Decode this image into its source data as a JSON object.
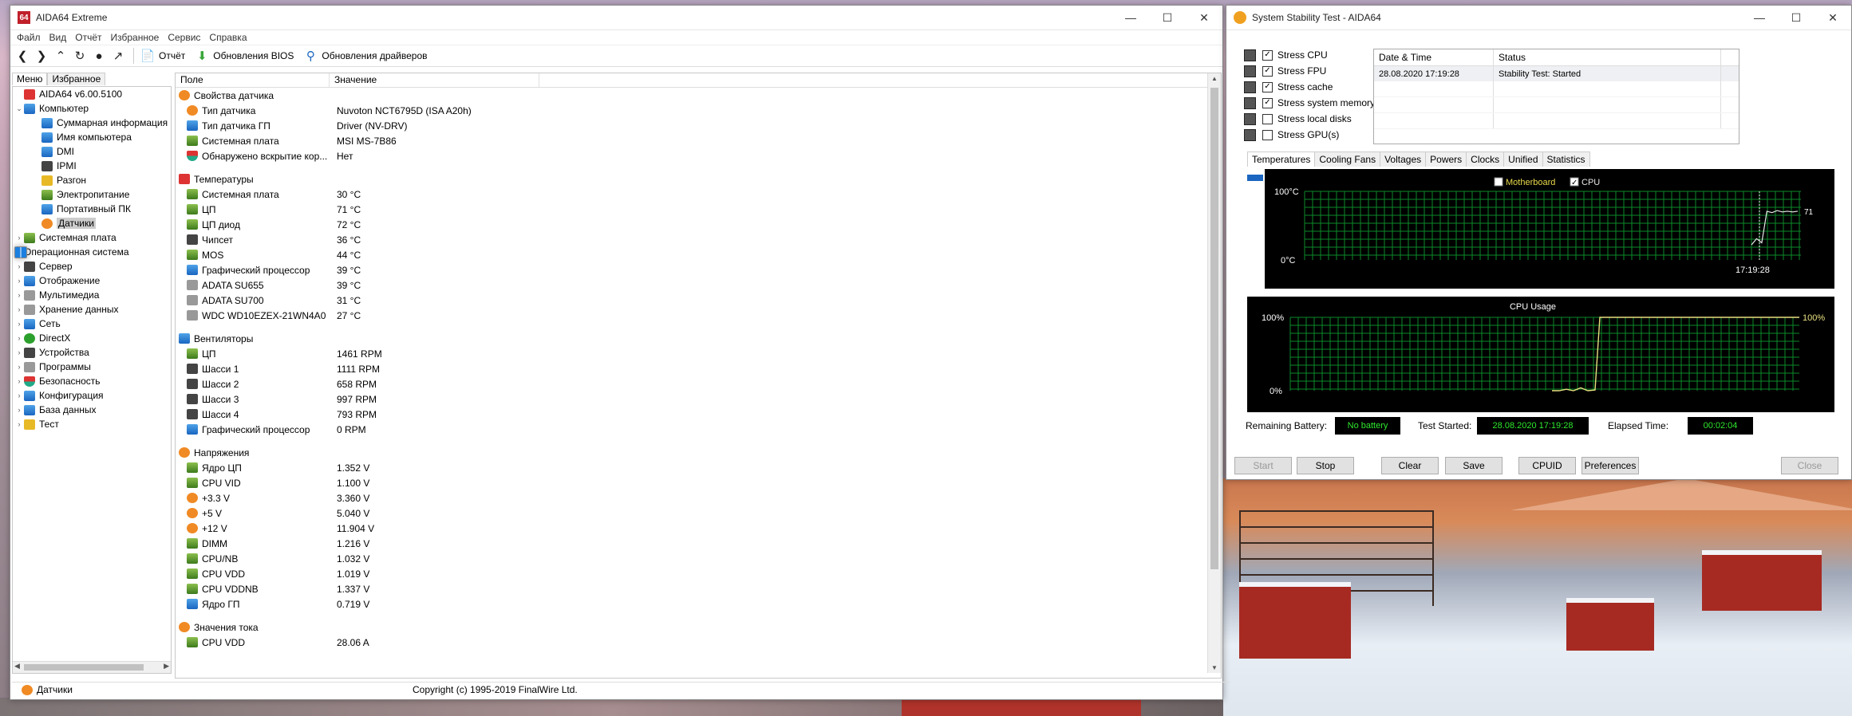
{
  "aida": {
    "title": "AIDA64 Extreme",
    "app_badge": "64",
    "menu": [
      "Файл",
      "Вид",
      "Отчёт",
      "Избранное",
      "Сервис",
      "Справка"
    ],
    "toolbar": {
      "report": "Отчёт",
      "bios": "Обновления BIOS",
      "drivers": "Обновления драйверов"
    },
    "left_tabs": [
      "Меню",
      "Избранное"
    ],
    "tree": [
      {
        "label": "AIDA64 v6.00.5100",
        "level": 0,
        "icon": "red",
        "exp": ""
      },
      {
        "label": "Компьютер",
        "level": 0,
        "icon": "blue",
        "exp": "v"
      },
      {
        "label": "Суммарная информация",
        "level": 2,
        "icon": "blue",
        "exp": ""
      },
      {
        "label": "Имя компьютера",
        "level": 2,
        "icon": "blue",
        "exp": ""
      },
      {
        "label": "DMI",
        "level": 2,
        "icon": "blue",
        "exp": ""
      },
      {
        "label": "IPMI",
        "level": 2,
        "icon": "dark",
        "exp": ""
      },
      {
        "label": "Разгон",
        "level": 2,
        "icon": "yellow",
        "exp": ""
      },
      {
        "label": "Электропитание",
        "level": 2,
        "icon": "green",
        "exp": ""
      },
      {
        "label": "Портативный ПК",
        "level": 2,
        "icon": "blue",
        "exp": ""
      },
      {
        "label": "Датчики",
        "level": 2,
        "icon": "orange",
        "exp": "",
        "selected": true
      },
      {
        "label": "Системная плата",
        "level": 0,
        "icon": "green",
        "exp": ">"
      },
      {
        "label": "Операционная система",
        "level": 0,
        "icon": "win",
        "exp": ">"
      },
      {
        "label": "Сервер",
        "level": 0,
        "icon": "dark",
        "exp": ">"
      },
      {
        "label": "Отображение",
        "level": 0,
        "icon": "blue",
        "exp": ">"
      },
      {
        "label": "Мультимедиа",
        "level": 0,
        "icon": "gray",
        "exp": ">"
      },
      {
        "label": "Хранение данных",
        "level": 0,
        "icon": "gray",
        "exp": ">"
      },
      {
        "label": "Сеть",
        "level": 0,
        "icon": "blue",
        "exp": ">"
      },
      {
        "label": "DirectX",
        "level": 0,
        "icon": "xbox",
        "exp": ">"
      },
      {
        "label": "Устройства",
        "level": 0,
        "icon": "dark",
        "exp": ">"
      },
      {
        "label": "Программы",
        "level": 0,
        "icon": "gray",
        "exp": ">"
      },
      {
        "label": "Безопасность",
        "level": 0,
        "icon": "shield",
        "exp": ">"
      },
      {
        "label": "Конфигурация",
        "level": 0,
        "icon": "blue",
        "exp": ">"
      },
      {
        "label": "База данных",
        "level": 0,
        "icon": "blue",
        "exp": ">"
      },
      {
        "label": "Тест",
        "level": 0,
        "icon": "yellow",
        "exp": ">"
      }
    ],
    "columns": [
      "Поле",
      "Значение"
    ],
    "rows": [
      {
        "type": "group",
        "field": "Свойства датчика",
        "icon": "orange"
      },
      {
        "field": "Тип датчика",
        "value": "Nuvoton NCT6795D  (ISA A20h)",
        "icon": "orange"
      },
      {
        "field": "Тип датчика ГП",
        "value": "Driver  (NV-DRV)",
        "icon": "blue"
      },
      {
        "field": "Системная плата",
        "value": "MSI MS-7B86",
        "icon": "green"
      },
      {
        "field": "Обнаружено вскрытие кор...",
        "value": "Нет",
        "icon": "shield"
      },
      {
        "type": "blank"
      },
      {
        "type": "group",
        "field": "Температуры",
        "icon": "red"
      },
      {
        "field": "Системная плата",
        "value": "30 °C",
        "icon": "green"
      },
      {
        "field": "ЦП",
        "value": "71 °C",
        "icon": "green"
      },
      {
        "field": "ЦП диод",
        "value": "72 °C",
        "icon": "green"
      },
      {
        "field": "Чипсет",
        "value": "36 °C",
        "icon": "dark"
      },
      {
        "field": "MOS",
        "value": "44 °C",
        "icon": "green"
      },
      {
        "field": "Графический процессор",
        "value": "39 °C",
        "icon": "blue"
      },
      {
        "field": "ADATA SU655",
        "value": "39 °C",
        "icon": "gray"
      },
      {
        "field": "ADATA SU700",
        "value": "31 °C",
        "icon": "gray"
      },
      {
        "field": "WDC WD10EZEX-21WN4A0",
        "value": "27 °C",
        "icon": "gray"
      },
      {
        "type": "blank"
      },
      {
        "type": "group",
        "field": "Вентиляторы",
        "icon": "blue"
      },
      {
        "field": "ЦП",
        "value": "1461 RPM",
        "icon": "green"
      },
      {
        "field": "Шасси 1",
        "value": "1111 RPM",
        "icon": "dark"
      },
      {
        "field": "Шасси 2",
        "value": "658 RPM",
        "icon": "dark"
      },
      {
        "field": "Шасси 3",
        "value": "997 RPM",
        "icon": "dark"
      },
      {
        "field": "Шасси 4",
        "value": "793 RPM",
        "icon": "dark"
      },
      {
        "field": "Графический процессор",
        "value": "0 RPM",
        "icon": "blue"
      },
      {
        "type": "blank"
      },
      {
        "type": "group",
        "field": "Напряжения",
        "icon": "orange"
      },
      {
        "field": "Ядро ЦП",
        "value": "1.352 V",
        "icon": "green"
      },
      {
        "field": "CPU VID",
        "value": "1.100 V",
        "icon": "green"
      },
      {
        "field": "+3.3 V",
        "value": "3.360 V",
        "icon": "orange"
      },
      {
        "field": "+5 V",
        "value": "5.040 V",
        "icon": "orange"
      },
      {
        "field": "+12 V",
        "value": "11.904 V",
        "icon": "orange"
      },
      {
        "field": "DIMM",
        "value": "1.216 V",
        "icon": "green"
      },
      {
        "field": "CPU/NB",
        "value": "1.032 V",
        "icon": "green"
      },
      {
        "field": "CPU VDD",
        "value": "1.019 V",
        "icon": "green"
      },
      {
        "field": "CPU VDDNB",
        "value": "1.337 V",
        "icon": "green"
      },
      {
        "field": "Ядро ГП",
        "value": "0.719 V",
        "icon": "blue"
      },
      {
        "type": "blank"
      },
      {
        "type": "group",
        "field": "Значения тока",
        "icon": "orange"
      },
      {
        "field": "CPU VDD",
        "value": "28.06 A",
        "icon": "green"
      }
    ],
    "status_left": "Датчики",
    "status_right": "Copyright (c) 1995-2019 FinalWire Ltd."
  },
  "sst": {
    "title": "System Stability Test - AIDA64",
    "options": [
      {
        "label": "Stress CPU",
        "checked": true
      },
      {
        "label": "Stress FPU",
        "checked": true
      },
      {
        "label": "Stress cache",
        "checked": true
      },
      {
        "label": "Stress system memory",
        "checked": true
      },
      {
        "label": "Stress local disks",
        "checked": false
      },
      {
        "label": "Stress GPU(s)",
        "checked": false
      }
    ],
    "log_headers": [
      "Date & Time",
      "Status"
    ],
    "log_rows": [
      {
        "time": "28.08.2020 17:19:28",
        "status": "Stability Test: Started"
      }
    ],
    "tabs": [
      "Temperatures",
      "Cooling Fans",
      "Voltages",
      "Powers",
      "Clocks",
      "Unified",
      "Statistics"
    ],
    "temp_graph": {
      "legend": [
        {
          "label": "Motherboard",
          "checked": false,
          "color": "#e8d84a"
        },
        {
          "label": "CPU",
          "checked": true,
          "color": "#e8e8e8"
        }
      ],
      "y_max": "100°C",
      "y_min": "0°C",
      "time_label": "17:19:28",
      "current": "71",
      "series": [
        {
          "name": "CPU",
          "values": [
            22,
            31,
            25,
            71,
            69,
            72,
            70,
            71,
            70,
            71
          ]
        }
      ],
      "grid_color": "#0c8a2a"
    },
    "cpu_graph": {
      "title": "CPU Usage",
      "y_max": "100%",
      "y_min": "0%",
      "current": "100%",
      "values": [
        0,
        0,
        2,
        0,
        4,
        0,
        1,
        100,
        100,
        100,
        100,
        100,
        100,
        100,
        100,
        100,
        100
      ],
      "line_color": "#e8e080"
    },
    "battery_label": "Remaining Battery:",
    "battery_value": "No battery",
    "started_label": "Test Started:",
    "started_value": "28.08.2020 17:19:28",
    "elapsed_label": "Elapsed Time:",
    "elapsed_value": "00:02:04",
    "buttons": [
      "Start",
      "Stop",
      "Clear",
      "Save",
      "CPUID",
      "Preferences",
      "Close"
    ]
  }
}
